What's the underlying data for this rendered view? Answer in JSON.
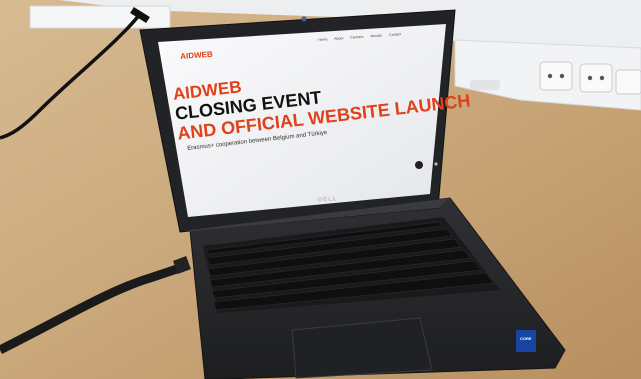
{
  "website": {
    "logo": "AIDWEB",
    "nav": [
      "Home",
      "About",
      "Partners",
      "Results",
      "Contact"
    ],
    "headline_1": "AIDWEB",
    "headline_2": "CLOSING EVENT",
    "headline_3": "AND OFFICIAL WEBSITE LAUNCH",
    "subtitle": "Erasmus+ cooperation between Belgium and Türkiye"
  },
  "laptop": {
    "brand": "DELL",
    "sticker": "CORE"
  },
  "colors": {
    "accent": "#e0401a",
    "table": "#c9a77a",
    "laptop_body": "#2a2a2c",
    "screen_bg": "#f4f5f7",
    "wall": "#e9ebee"
  }
}
